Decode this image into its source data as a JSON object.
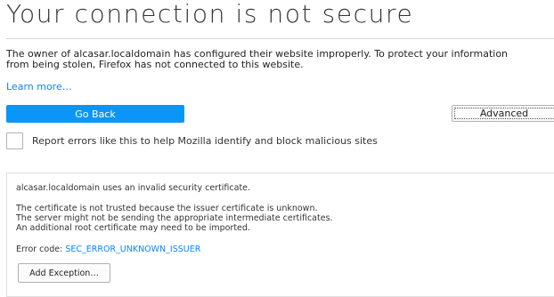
{
  "title": "Your connection is not secure",
  "description": {
    "line1": "The owner of alcasar.localdomain has configured their website improperly. To protect your information",
    "line2": "from being stolen, Firefox has not connected to this website."
  },
  "learn_more": "Learn more…",
  "buttons": {
    "go_back": "Go Back",
    "advanced": "Advanced",
    "add_exception": "Add Exception…"
  },
  "report": {
    "label": "Report errors like this to help Mozilla identify and block malicious sites",
    "checked": false
  },
  "advanced_panel": {
    "intro": "alcasar.localdomain uses an invalid security certificate.",
    "reasons": [
      "The certificate is not trusted because the issuer certificate is unknown.",
      "The server might not be sending the appropriate intermediate certificates.",
      "An additional root certificate may need to be imported."
    ],
    "error_code_label": "Error code:",
    "error_code": "SEC_ERROR_UNKNOWN_ISSUER"
  },
  "colors": {
    "primary_button": "#0996f8",
    "link": "#0a84ff",
    "text": "#333333"
  }
}
